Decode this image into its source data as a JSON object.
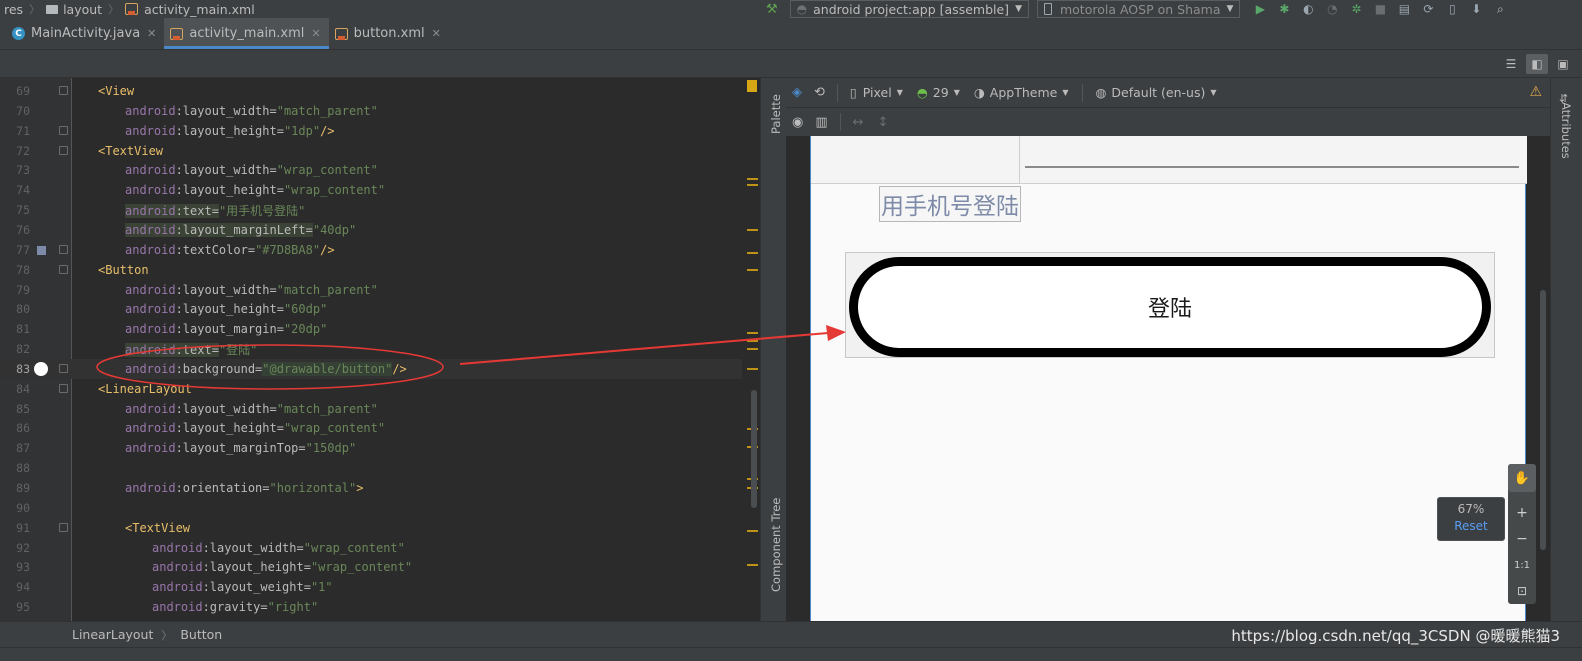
{
  "breadcrumb": {
    "items": [
      "res",
      "layout",
      "activity_main.xml"
    ]
  },
  "run_config": {
    "config_label": "android project:app [assemble]",
    "device_label": "motorola AOSP on Shama"
  },
  "tabs": [
    {
      "label": "MainActivity.java",
      "active": false
    },
    {
      "label": "activity_main.xml",
      "active": true
    },
    {
      "label": "button.xml",
      "active": false
    }
  ],
  "design_toolbar": {
    "device": "Pixel",
    "api": "29",
    "theme": "AppTheme",
    "locale": "Default (en-us)"
  },
  "side_panels": {
    "palette": "Palette",
    "component_tree": "Component Tree",
    "attributes": "Attributes"
  },
  "code_lines": [
    {
      "n": "69",
      "indent": 0,
      "parts": [
        [
          "tg",
          "<View"
        ]
      ]
    },
    {
      "n": "70",
      "indent": 1,
      "parts": [
        [
          "ns",
          "android"
        ],
        [
          "at",
          ":layout_width="
        ],
        [
          "st",
          "\"match_parent\""
        ]
      ]
    },
    {
      "n": "71",
      "indent": 1,
      "parts": [
        [
          "ns",
          "android"
        ],
        [
          "at",
          ":layout_height="
        ],
        [
          "st",
          "\"1dp\""
        ],
        [
          "tg",
          "/>"
        ]
      ]
    },
    {
      "n": "72",
      "indent": 0,
      "parts": [
        [
          "tg",
          "<TextView"
        ]
      ]
    },
    {
      "n": "73",
      "indent": 1,
      "parts": [
        [
          "ns",
          "android"
        ],
        [
          "at",
          ":layout_width="
        ],
        [
          "st",
          "\"wrap_content\""
        ]
      ]
    },
    {
      "n": "74",
      "indent": 1,
      "parts": [
        [
          "ns",
          "android"
        ],
        [
          "at",
          ":layout_height="
        ],
        [
          "st",
          "\"wrap_content\""
        ]
      ]
    },
    {
      "n": "75",
      "indent": 1,
      "hl": true,
      "parts": [
        [
          "ns",
          "android"
        ],
        [
          "at",
          ":text="
        ],
        [
          "st",
          "\"用手机号登陆\""
        ]
      ]
    },
    {
      "n": "76",
      "indent": 1,
      "hl": true,
      "parts": [
        [
          "ns",
          "android"
        ],
        [
          "at",
          ":layout_marginLeft="
        ],
        [
          "st",
          "\"40dp\""
        ]
      ]
    },
    {
      "n": "77",
      "indent": 1,
      "parts": [
        [
          "ns",
          "android"
        ],
        [
          "at",
          ":textColor="
        ],
        [
          "st",
          "\"#7D8BA8\""
        ],
        [
          "tg",
          "/>"
        ]
      ]
    },
    {
      "n": "78",
      "indent": 0,
      "parts": [
        [
          "tg",
          "<Button"
        ]
      ]
    },
    {
      "n": "79",
      "indent": 1,
      "parts": [
        [
          "ns",
          "android"
        ],
        [
          "at",
          ":layout_width="
        ],
        [
          "st",
          "\"match_parent\""
        ]
      ]
    },
    {
      "n": "80",
      "indent": 1,
      "parts": [
        [
          "ns",
          "android"
        ],
        [
          "at",
          ":layout_height="
        ],
        [
          "st",
          "\"60dp\""
        ]
      ]
    },
    {
      "n": "81",
      "indent": 1,
      "parts": [
        [
          "ns",
          "android"
        ],
        [
          "at",
          ":layout_margin="
        ],
        [
          "st",
          "\"20dp\""
        ]
      ]
    },
    {
      "n": "82",
      "indent": 1,
      "hl": true,
      "parts": [
        [
          "ns",
          "android"
        ],
        [
          "at",
          ":text="
        ],
        [
          "st",
          "\"登陆\""
        ]
      ]
    },
    {
      "n": "83",
      "indent": 1,
      "current": true,
      "parts": [
        [
          "ns",
          "android"
        ],
        [
          "at",
          ":background="
        ],
        [
          "st",
          "\"@drawable/button\""
        ],
        [
          "tg",
          "/>"
        ]
      ]
    },
    {
      "n": "84",
      "indent": 0,
      "parts": [
        [
          "tg",
          "<LinearLayout"
        ]
      ]
    },
    {
      "n": "85",
      "indent": 1,
      "parts": [
        [
          "ns",
          "android"
        ],
        [
          "at",
          ":layout_width="
        ],
        [
          "st",
          "\"match_parent\""
        ]
      ]
    },
    {
      "n": "86",
      "indent": 1,
      "parts": [
        [
          "ns",
          "android"
        ],
        [
          "at",
          ":layout_height="
        ],
        [
          "st",
          "\"wrap_content\""
        ]
      ]
    },
    {
      "n": "87",
      "indent": 1,
      "parts": [
        [
          "ns",
          "android"
        ],
        [
          "at",
          ":layout_marginTop="
        ],
        [
          "st",
          "\"150dp\""
        ]
      ]
    },
    {
      "n": "88",
      "indent": 1,
      "parts": []
    },
    {
      "n": "89",
      "indent": 1,
      "parts": [
        [
          "ns",
          "android"
        ],
        [
          "at",
          ":orientation="
        ],
        [
          "st",
          "\"horizontal\""
        ],
        [
          "tg",
          ">"
        ]
      ]
    },
    {
      "n": "90",
      "indent": 1,
      "parts": []
    },
    {
      "n": "91",
      "indent": 1,
      "parts": [
        [
          "tg",
          "<TextView"
        ]
      ]
    },
    {
      "n": "92",
      "indent": 2,
      "parts": [
        [
          "ns",
          "android"
        ],
        [
          "at",
          ":layout_width="
        ],
        [
          "st",
          "\"wrap_content\""
        ]
      ]
    },
    {
      "n": "93",
      "indent": 2,
      "parts": [
        [
          "ns",
          "android"
        ],
        [
          "at",
          ":layout_height="
        ],
        [
          "st",
          "\"wrap_content\""
        ]
      ]
    },
    {
      "n": "94",
      "indent": 2,
      "parts": [
        [
          "ns",
          "android"
        ],
        [
          "at",
          ":layout_weight="
        ],
        [
          "st",
          "\"1\""
        ]
      ]
    },
    {
      "n": "95",
      "indent": 2,
      "parts": [
        [
          "ns",
          "android"
        ],
        [
          "at",
          ":gravity="
        ],
        [
          "st",
          "\"right\""
        ]
      ]
    }
  ],
  "preview": {
    "phone_text": "用手机号登陆",
    "phone_text_color": "#7D8BA8",
    "button_text": "登陆"
  },
  "zoom": {
    "level": "67%",
    "reset": "Reset",
    "one_to_one": "1:1"
  },
  "bottom_breadcrumb": [
    "LinearLayout",
    "Button"
  ],
  "watermark": "https://blog.csdn.net/qq_3CSDN @暖暖熊猫3",
  "colors": {
    "accent": "#4a88c7",
    "annotation": "#e53935"
  }
}
